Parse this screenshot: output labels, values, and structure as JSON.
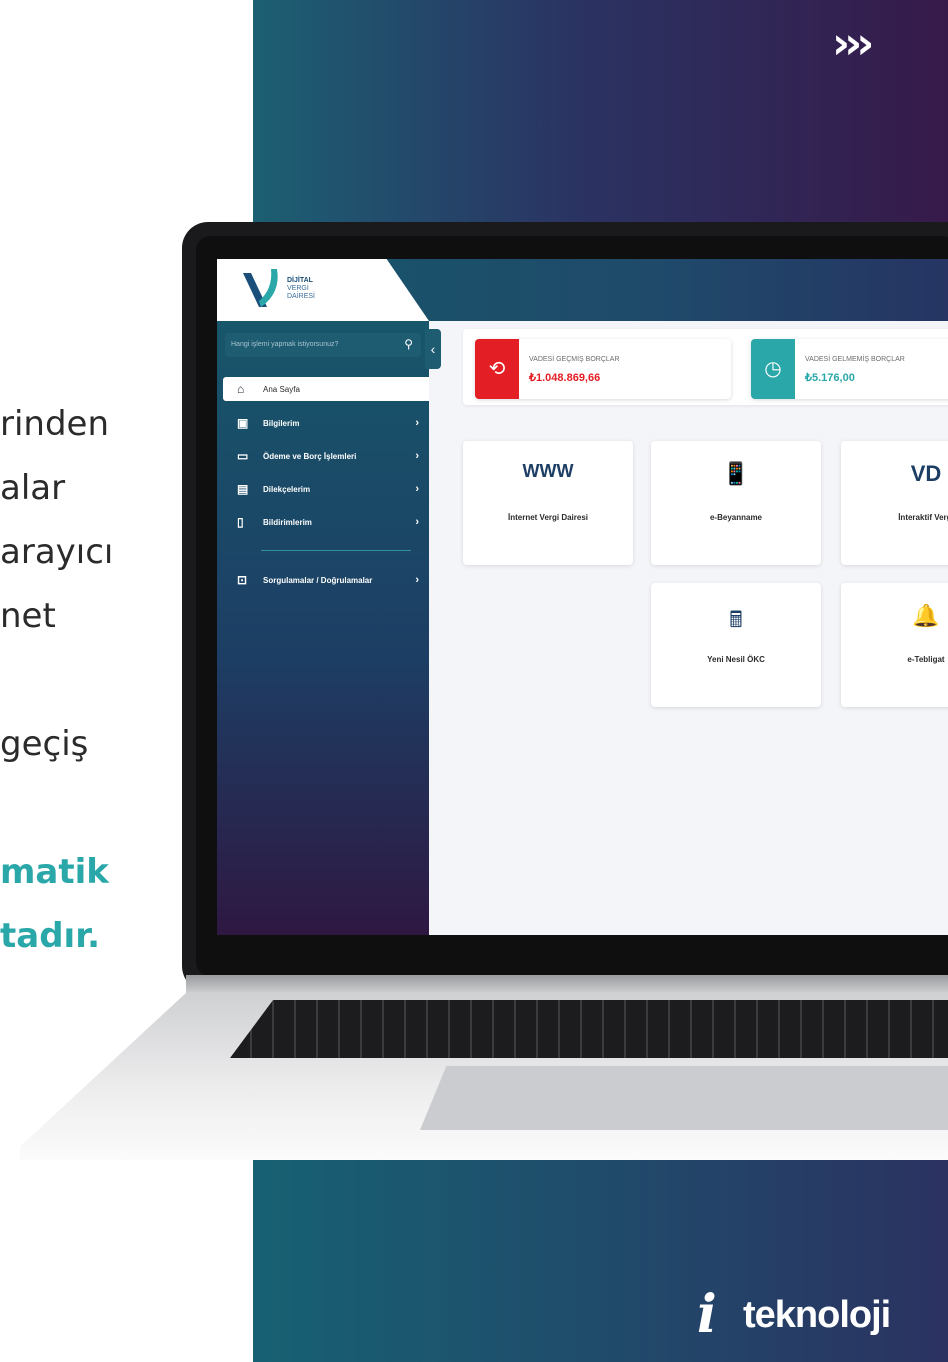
{
  "decor": {
    "chevrons": "›››"
  },
  "left_text": {
    "lines": [
      "rinden",
      "alar",
      "arayıcı",
      "net",
      "geçiş"
    ],
    "teal_lines": [
      "matik",
      "tadır."
    ]
  },
  "app": {
    "logo": {
      "line1": "DİJİTAL",
      "line2": "VERGİ",
      "line3": "DAİRESİ"
    },
    "search": {
      "placeholder": "Hangi işlemi yapmak istiyorsunuz?",
      "icon": "search-icon"
    },
    "collapse_icon": "‹",
    "sidebar": {
      "active": {
        "label": "Ana Sayfa",
        "icon": "home-icon"
      },
      "items": [
        {
          "label": "Bilgilerim",
          "icon": "id-card-icon"
        },
        {
          "label": "Ödeme ve Borç İşlemleri",
          "icon": "credit-card-icon"
        },
        {
          "label": "Dilekçelerim",
          "icon": "document-icon"
        },
        {
          "label": "Bildirimlerim",
          "icon": "bookmark-icon"
        },
        {
          "label": "Sorgulamalar / Doğrulamalar",
          "icon": "search-window-icon"
        }
      ],
      "chevron": "›"
    },
    "debts": [
      {
        "caption": "VADESİ GEÇMİŞ BORÇLAR",
        "amount": "₺1.048.869,66",
        "color": "#e31e24",
        "icon": "overdue-clock-icon"
      },
      {
        "caption": "VADESİ GELMEMİŞ BORÇLAR",
        "amount": "₺5.176,00",
        "color": "#2aa7a9",
        "icon": "upcoming-clock-icon"
      }
    ],
    "tiles": [
      {
        "label": "İnternet Vergi Dairesi",
        "icon": "www-icon",
        "glyph": "WWW"
      },
      {
        "label": "e-Beyanname",
        "icon": "mobile-document-icon",
        "glyph": "📱"
      },
      {
        "label": "İnteraktif Vergi",
        "icon": "vd-logo-icon",
        "glyph": "VD"
      },
      {
        "label": "Yeni Nesil ÖKC",
        "icon": "pos-device-icon",
        "glyph": "🖩"
      },
      {
        "label": "e-Tebligat",
        "icon": "bell-icon",
        "glyph": "🔔"
      }
    ]
  },
  "brand": {
    "mark": "i",
    "word": "teknoloji"
  },
  "colors": {
    "teal": "#2aa7a9",
    "red": "#e31e24",
    "navy": "#1d3e64"
  }
}
